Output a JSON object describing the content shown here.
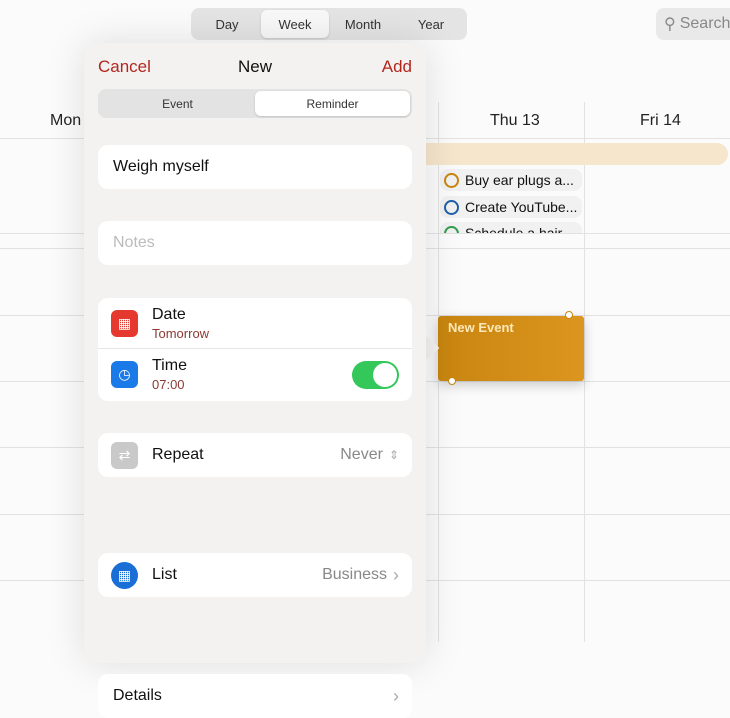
{
  "view_switcher": {
    "options": [
      "Day",
      "Week",
      "Month",
      "Year"
    ],
    "selected": "Week"
  },
  "search": {
    "placeholder": "Search"
  },
  "calendar": {
    "days": [
      "Mon",
      "Thu 13",
      "Fri 14"
    ],
    "reminders": [
      {
        "title": "Buy ear plugs a...",
        "color": "#c8850f"
      },
      {
        "title": "Create YouTube...",
        "color": "#1f5fa8"
      },
      {
        "title": "Schedule a hair...",
        "color": "#2e9e4f"
      }
    ],
    "new_event": {
      "title": "New Event",
      "color": "#d08c16"
    }
  },
  "popover": {
    "cancel": "Cancel",
    "title": "New",
    "add": "Add",
    "tabs": [
      "Event",
      "Reminder"
    ],
    "selected_tab": "Reminder",
    "title_value": "Weigh myself",
    "notes_placeholder": "Notes",
    "date": {
      "label": "Date",
      "value": "Tomorrow"
    },
    "time": {
      "label": "Time",
      "value": "07:00",
      "enabled": true
    },
    "repeat": {
      "label": "Repeat",
      "value": "Never"
    },
    "list": {
      "label": "List",
      "value": "Business"
    },
    "details": {
      "label": "Details"
    }
  }
}
